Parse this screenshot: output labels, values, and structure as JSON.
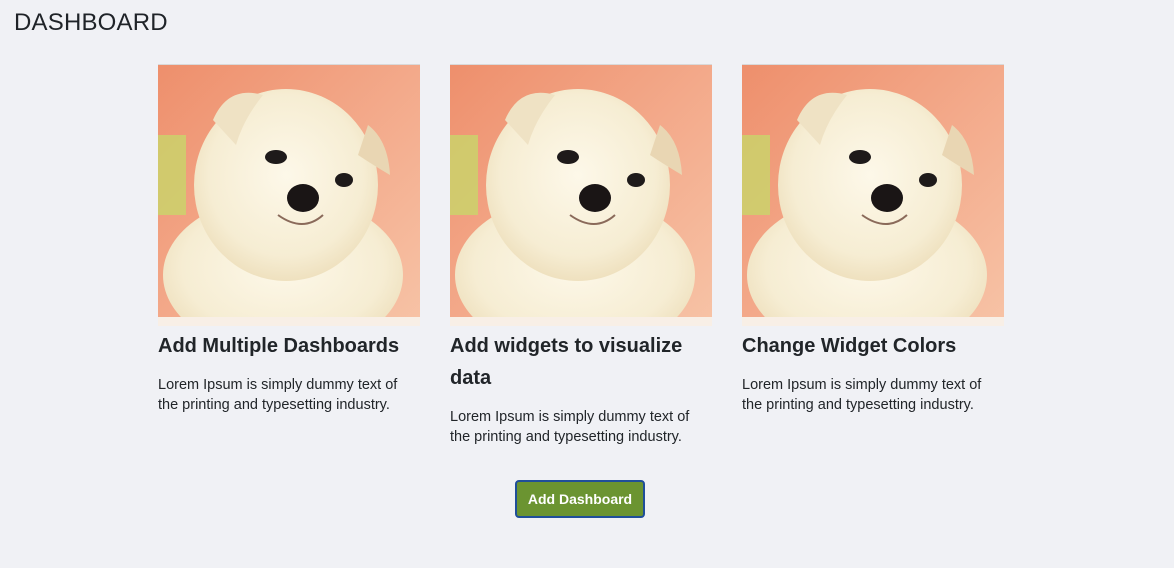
{
  "header": {
    "title": "DASHBOARD"
  },
  "cards": [
    {
      "image_icon": "puppy-photo",
      "title": "Add Multiple Dashboards",
      "text": "Lorem Ipsum is simply dummy text of the printing and typesetting industry."
    },
    {
      "image_icon": "puppy-photo",
      "title": "Add widgets to visualize data",
      "text": "Lorem Ipsum is simply dummy text of the printing and typesetting industry."
    },
    {
      "image_icon": "puppy-photo",
      "title": "Change Widget Colors",
      "text": "Lorem Ipsum is simply dummy text of the printing and typesetting industry."
    }
  ],
  "actions": {
    "add_dashboard_label": "Add Dashboard"
  },
  "colors": {
    "background": "#f0f1f5",
    "button_fill": "#6b9431",
    "button_border": "#1f4f9a",
    "image_bg_salmon": "#f0a07e",
    "image_bg_green": "#c8d26a"
  }
}
